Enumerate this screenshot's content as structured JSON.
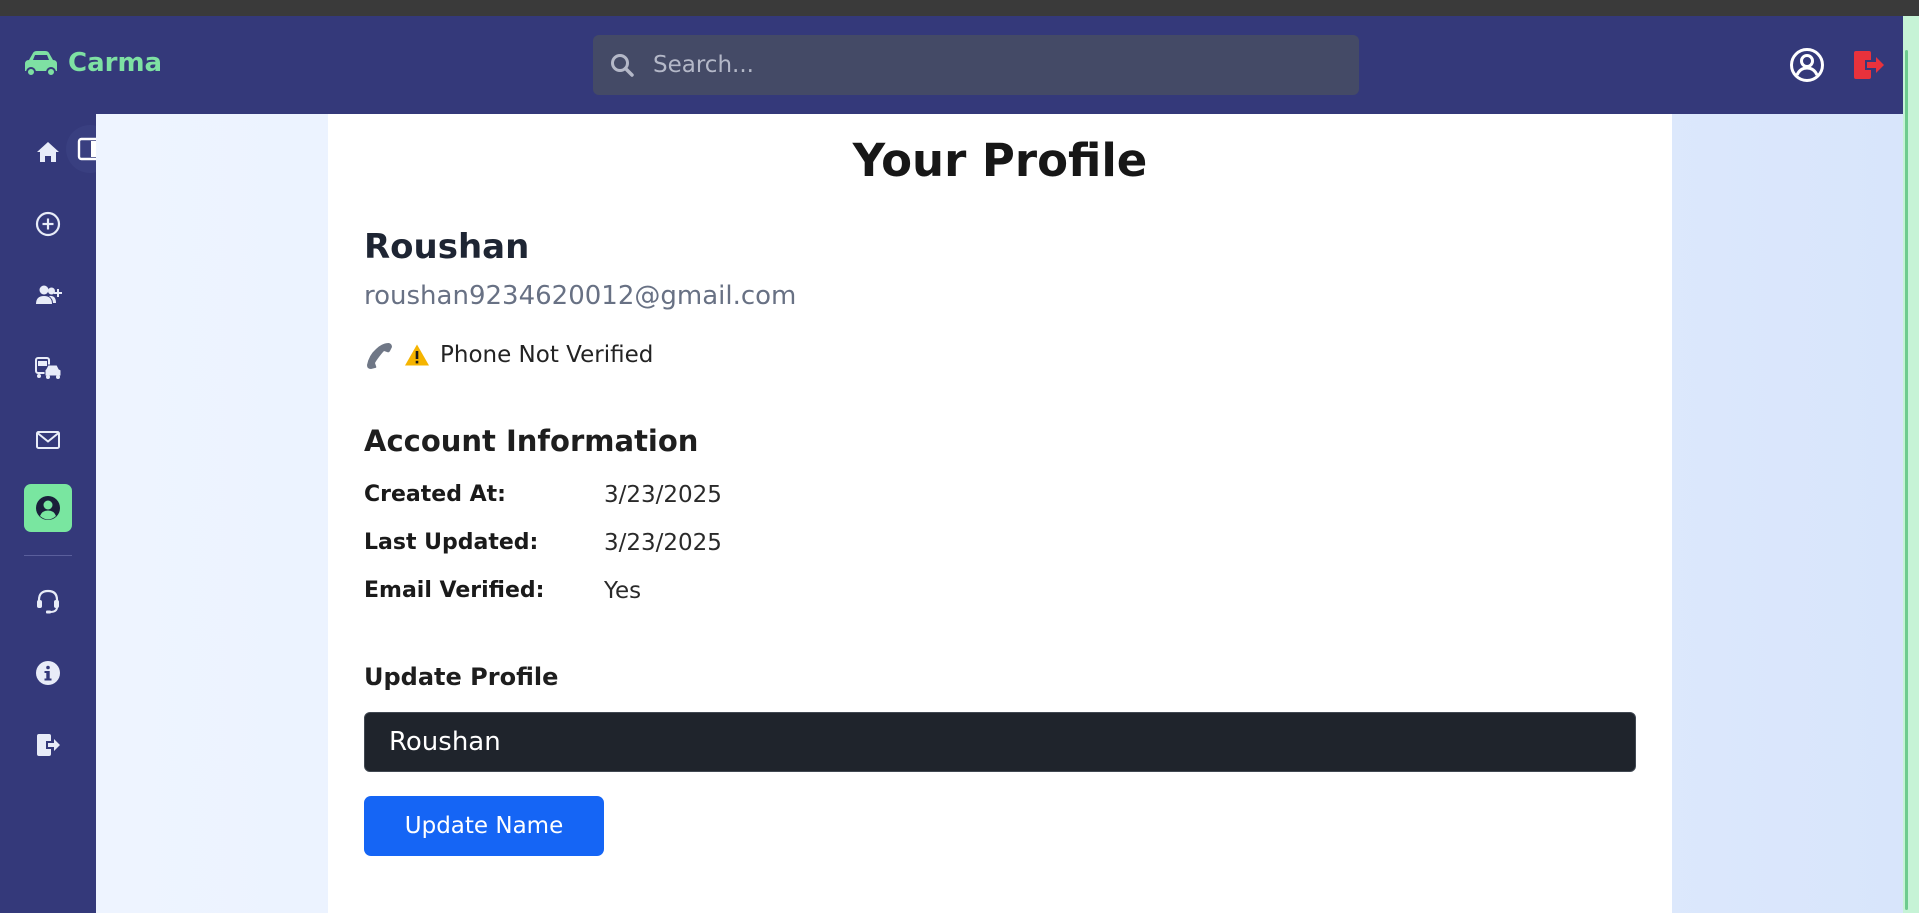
{
  "app": {
    "brand": "Carma"
  },
  "header": {
    "search_placeholder": "Search...",
    "icons": [
      "car-icon",
      "search-icon",
      "user-circle-icon",
      "logout-icon"
    ]
  },
  "sidebar": {
    "items": [
      {
        "icon": "home-icon",
        "active": false
      },
      {
        "icon": "plus-circle-icon",
        "active": false
      },
      {
        "icon": "user-plus-icon",
        "active": false
      },
      {
        "icon": "vehicles-icon",
        "active": false
      },
      {
        "icon": "mail-icon",
        "active": false
      },
      {
        "icon": "user-circle-icon",
        "active": true
      },
      {
        "icon": "headset-icon",
        "active": false
      },
      {
        "icon": "info-icon",
        "active": false
      },
      {
        "icon": "sign-out-icon",
        "active": false
      }
    ],
    "collapse_icon": "sidebar-toggle-icon"
  },
  "profile": {
    "title": "Your Profile",
    "name": "Roushan",
    "email": "roushan9234620012@gmail.com",
    "phone_status": "Phone Not Verified",
    "account": {
      "title": "Account Information",
      "rows": [
        {
          "label": "Created At:",
          "value": "3/23/2025"
        },
        {
          "label": "Last Updated:",
          "value": "3/23/2025"
        },
        {
          "label": "Email Verified:",
          "value": "Yes"
        }
      ]
    },
    "update": {
      "title": "Update Profile",
      "name_value": "Roushan",
      "button_label": "Update Name"
    }
  },
  "colors": {
    "nav_bg": "#34397a",
    "brand": "#7ee0a3",
    "active_item": "#79e6a0",
    "logout": "#e8323c",
    "warning": "#f5b400",
    "primary_button": "#1565f5"
  }
}
